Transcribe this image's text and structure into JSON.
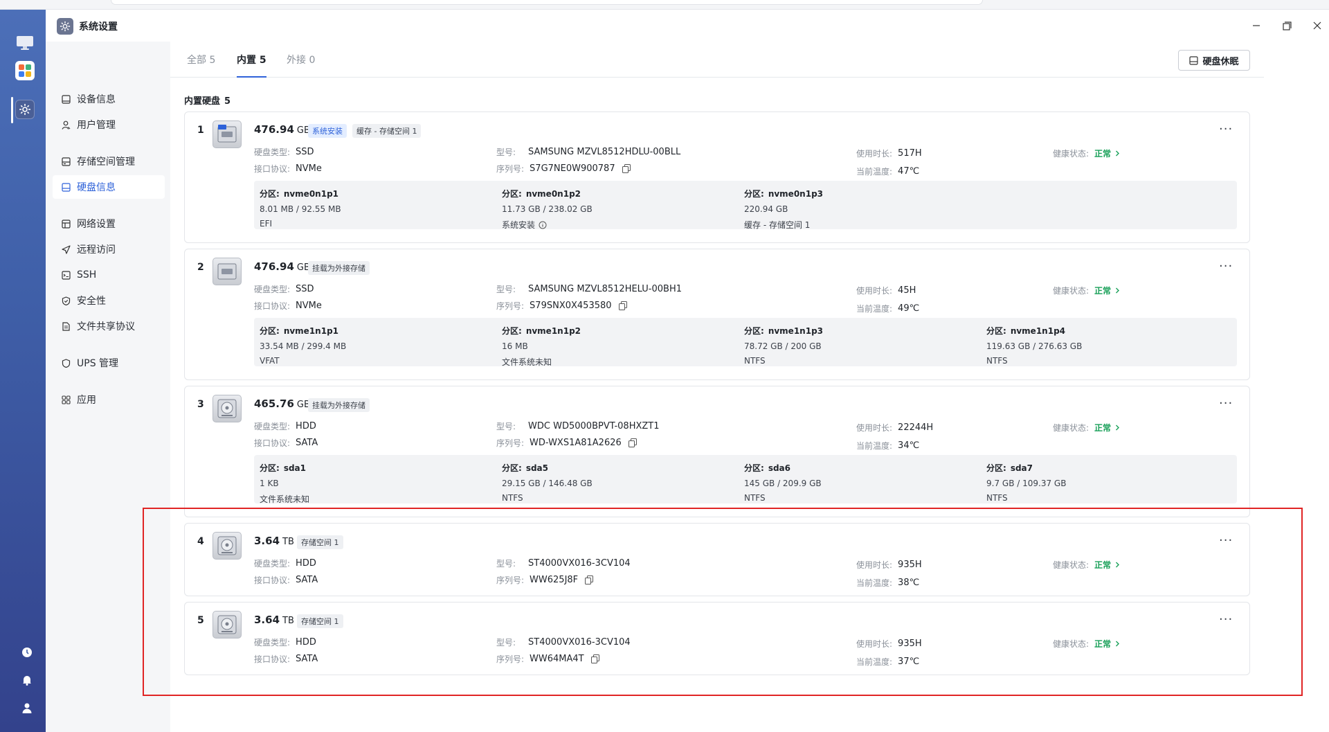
{
  "window": {
    "title": "系统设置"
  },
  "sidebar": {
    "items": [
      {
        "label": "设备信息",
        "icon": "monitor-icon"
      },
      {
        "label": "用户管理",
        "icon": "user-icon"
      },
      {
        "label": "存储空间管理",
        "icon": "storage-icon"
      },
      {
        "label": "硬盘信息",
        "icon": "disk-icon",
        "active": true
      },
      {
        "label": "网络设置",
        "icon": "network-icon"
      },
      {
        "label": "远程访问",
        "icon": "send-icon"
      },
      {
        "label": "SSH",
        "icon": "terminal-icon"
      },
      {
        "label": "安全性",
        "icon": "shield-icon"
      },
      {
        "label": "文件共享协议",
        "icon": "file-icon"
      },
      {
        "label": "UPS 管理",
        "icon": "ups-shield-icon"
      },
      {
        "label": "应用",
        "icon": "apps-icon"
      }
    ]
  },
  "tabs": [
    {
      "label": "全部 5"
    },
    {
      "label": "内置 5",
      "active": true
    },
    {
      "label": "外接 0"
    }
  ],
  "sleep_button": "硬盘休眠",
  "section": {
    "title": "内置硬盘",
    "count": "5"
  },
  "labels": {
    "disk_type": "硬盘类型:",
    "interface": "接口协议:",
    "model": "型号:",
    "serial": "序列号:",
    "uptime": "使用时长:",
    "temp": "当前温度:",
    "health": "健康状态:",
    "partition": "分区:"
  },
  "disks": [
    {
      "index": "1",
      "size": "476.94",
      "unit": "GB",
      "tags": [
        "系统安装",
        "缓存 - 存储空间 1"
      ],
      "type": "SSD",
      "interface": "NVMe",
      "model": "SAMSUNG MZVL8512HDLU-00BLL",
      "serial": "S7G7NE0W900787",
      "uptime": "517H",
      "temp": "47℃",
      "health": "正常",
      "partitions": [
        {
          "name": "nvme0n1p1",
          "size": "8.01 MB / 92.55 MB",
          "fs": "EFI"
        },
        {
          "name": "nvme0n1p2",
          "size": "11.73 GB / 238.02 GB",
          "fs": "系统安装"
        },
        {
          "name": "nvme0n1p3",
          "size": "220.94 GB",
          "fs": "缓存 - 存储空间 1"
        }
      ]
    },
    {
      "index": "2",
      "size": "476.94",
      "unit": "GB",
      "tags": [
        "挂载为外接存储"
      ],
      "type": "SSD",
      "interface": "NVMe",
      "model": "SAMSUNG MZVL8512HELU-00BH1",
      "serial": "S79SNX0X453580",
      "uptime": "45H",
      "temp": "49℃",
      "health": "正常",
      "partitions": [
        {
          "name": "nvme1n1p1",
          "size": "33.54 MB / 299.4 MB",
          "fs": "VFAT"
        },
        {
          "name": "nvme1n1p2",
          "size": "16 MB",
          "fs": "文件系统未知"
        },
        {
          "name": "nvme1n1p3",
          "size": "78.72 GB / 200 GB",
          "fs": "NTFS"
        },
        {
          "name": "nvme1n1p4",
          "size": "119.63 GB / 276.63 GB",
          "fs": "NTFS"
        }
      ]
    },
    {
      "index": "3",
      "size": "465.76",
      "unit": "GB",
      "tags": [
        "挂载为外接存储"
      ],
      "type": "HDD",
      "interface": "SATA",
      "model": "WDC WD5000BPVT-08HXZT1",
      "serial": "WD-WXS1A81A2626",
      "uptime": "22244H",
      "temp": "34℃",
      "health": "正常",
      "partitions": [
        {
          "name": "sda1",
          "size": "1 KB",
          "fs": "文件系统未知"
        },
        {
          "name": "sda5",
          "size": "29.15 GB / 146.48 GB",
          "fs": "NTFS"
        },
        {
          "name": "sda6",
          "size": "145 GB / 209.9 GB",
          "fs": "NTFS"
        },
        {
          "name": "sda7",
          "size": "9.7 GB / 109.37 GB",
          "fs": "NTFS"
        }
      ]
    },
    {
      "index": "4",
      "size": "3.64",
      "unit": "TB",
      "tags": [
        "存储空间 1"
      ],
      "type": "HDD",
      "interface": "SATA",
      "model": "ST4000VX016-3CV104",
      "serial": "WW625J8F",
      "uptime": "935H",
      "temp": "38℃",
      "health": "正常",
      "partitions": []
    },
    {
      "index": "5",
      "size": "3.64",
      "unit": "TB",
      "tags": [
        "存储空间 1"
      ],
      "type": "HDD",
      "interface": "SATA",
      "model": "ST4000VX016-3CV104",
      "serial": "WW64MA4T",
      "uptime": "935H",
      "temp": "37℃",
      "health": "正常",
      "partitions": []
    }
  ],
  "colors": {
    "accent": "#2e62d9",
    "ok": "#18a058",
    "highlight": "#e02424"
  }
}
